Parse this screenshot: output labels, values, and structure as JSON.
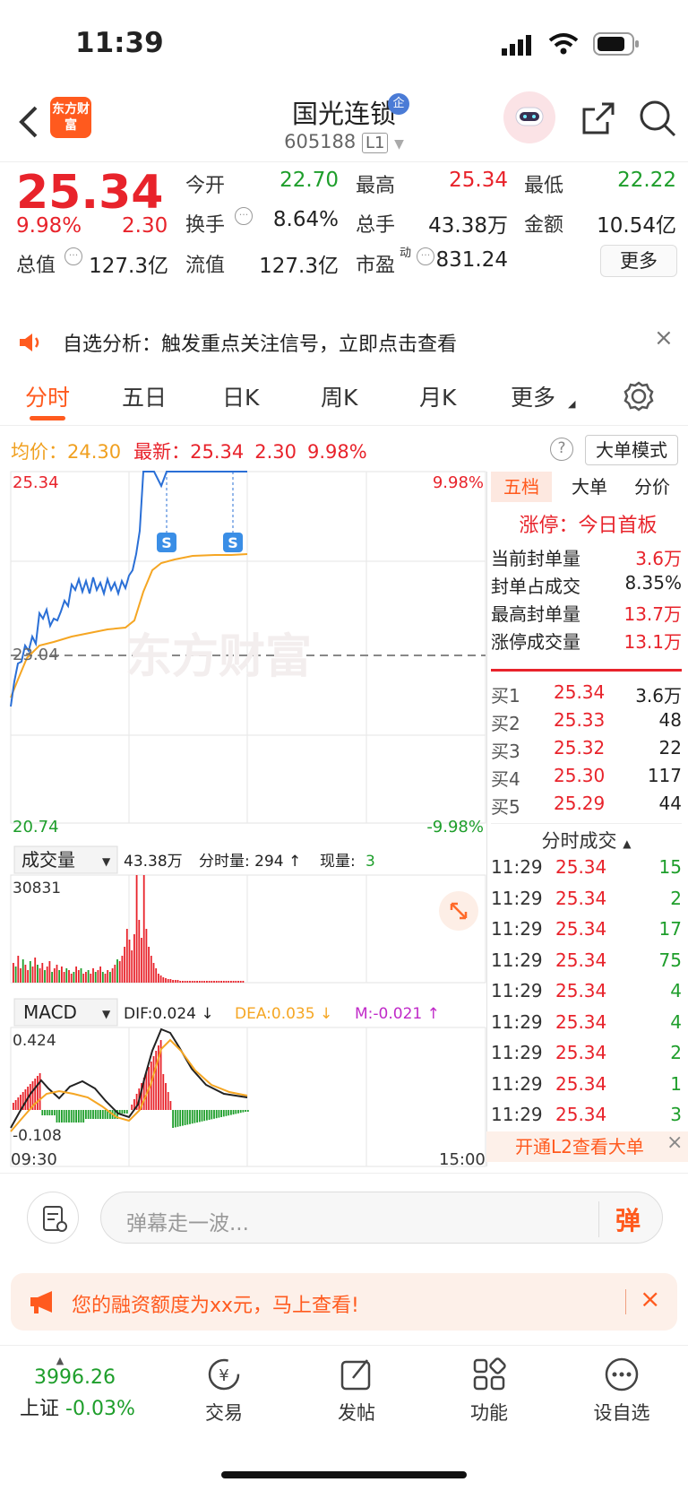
{
  "status": {
    "time": "11:39"
  },
  "header": {
    "logo": "东方财富",
    "title": "国光连锁",
    "code": "605188",
    "level": "L1"
  },
  "quote": {
    "price": "25.34",
    "pct": "9.98%",
    "chg": "2.30",
    "items": [
      {
        "label": "今开",
        "value": "22.70",
        "color": "green"
      },
      {
        "label": "最高",
        "value": "25.34",
        "color": "red"
      },
      {
        "label": "最低",
        "value": "22.22",
        "color": "green"
      },
      {
        "label": "换手",
        "value": "8.64%",
        "color": "dark"
      },
      {
        "label": "总手",
        "value": "43.38万",
        "color": "dark"
      },
      {
        "label": "金额",
        "value": "10.54亿",
        "color": "dark"
      },
      {
        "label": "总值",
        "value": "127.3亿",
        "color": "dark"
      },
      {
        "label": "流值",
        "value": "127.3亿",
        "color": "dark"
      },
      {
        "label": "市盈",
        "value": "831.24",
        "color": "dark"
      }
    ],
    "pe_sup": "动",
    "more": "更多"
  },
  "notice": {
    "text": "自选分析：触发重点关注信号，立即点击查看"
  },
  "tabs": [
    "分时",
    "五日",
    "日K",
    "周K",
    "月K",
    "更多"
  ],
  "infoline": {
    "avg_label": "均价：",
    "avg": "24.30",
    "latest_label": "最新：",
    "latest": "25.34",
    "chg": "2.30",
    "pct": "9.98%",
    "mode": "大单模式"
  },
  "axis": {
    "top": "25.34",
    "top_pct": "9.98%",
    "mid": "23.04",
    "bottom": "20.74",
    "bottom_pct": "-9.98%",
    "watermark": "东方财富",
    "t_start": "09:30",
    "t_end": "15:00",
    "s_marker": "S"
  },
  "volume": {
    "label": "成交量",
    "total": "43.38万",
    "fenshi": "分时量: 294 ↑",
    "xian_label": "现量:",
    "xian": "3",
    "max": "30831"
  },
  "macd": {
    "label": "MACD",
    "dif": "DIF:0.024 ↓",
    "dea": "DEA:0.035 ↓",
    "m": "M:-0.021 ↑",
    "top": "0.424",
    "bottom": "-0.108"
  },
  "panel": {
    "tabs": [
      "五档",
      "大单",
      "分价"
    ],
    "limit_up": "涨停：今日首板",
    "seal": [
      {
        "label": "当前封单量",
        "value": "3.6万",
        "red": true
      },
      {
        "label": "封单占成交",
        "value": "8.35%",
        "red": false
      },
      {
        "label": "最高封单量",
        "value": "13.7万",
        "red": true
      },
      {
        "label": "涨停成交量",
        "value": "13.1万",
        "red": true
      }
    ],
    "bids": [
      {
        "label": "买1",
        "price": "25.34",
        "vol": "3.6万"
      },
      {
        "label": "买2",
        "price": "25.33",
        "vol": "48"
      },
      {
        "label": "买3",
        "price": "25.32",
        "vol": "22"
      },
      {
        "label": "买4",
        "price": "25.30",
        "vol": "117"
      },
      {
        "label": "买5",
        "price": "25.29",
        "vol": "44"
      }
    ],
    "trades_title": "分时成交",
    "trades": [
      {
        "t": "11:29",
        "p": "25.34",
        "v": "15"
      },
      {
        "t": "11:29",
        "p": "25.34",
        "v": "2"
      },
      {
        "t": "11:29",
        "p": "25.34",
        "v": "17"
      },
      {
        "t": "11:29",
        "p": "25.34",
        "v": "75"
      },
      {
        "t": "11:29",
        "p": "25.34",
        "v": "4"
      },
      {
        "t": "11:29",
        "p": "25.34",
        "v": "4"
      },
      {
        "t": "11:29",
        "p": "25.34",
        "v": "2"
      },
      {
        "t": "11:29",
        "p": "25.34",
        "v": "1"
      },
      {
        "t": "11:29",
        "p": "25.34",
        "v": "3"
      }
    ],
    "l2": "开通L2查看大单"
  },
  "danmu": {
    "placeholder": "弹幕走一波...",
    "btn": "弹"
  },
  "promo": {
    "text": "您的融资额度为xx元，马上查看!"
  },
  "nav": {
    "index_value": "3996.26",
    "index_name": "上证",
    "index_pct": "-0.03%",
    "items": [
      "交易",
      "发帖",
      "功能",
      "设自选"
    ]
  },
  "colors": {
    "red": "#e8232b",
    "green": "#1e9e2b",
    "orange": "#f0a020",
    "blue": "#2a6fd6",
    "accent": "#ff5a1e"
  }
}
